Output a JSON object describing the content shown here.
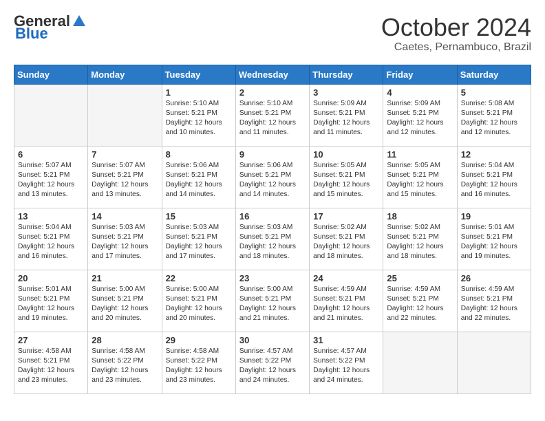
{
  "header": {
    "logo_general": "General",
    "logo_blue": "Blue",
    "month": "October 2024",
    "location": "Caetes, Pernambuco, Brazil"
  },
  "weekdays": [
    "Sunday",
    "Monday",
    "Tuesday",
    "Wednesday",
    "Thursday",
    "Friday",
    "Saturday"
  ],
  "weeks": [
    [
      {
        "day": "",
        "content": ""
      },
      {
        "day": "",
        "content": ""
      },
      {
        "day": "1",
        "content": "Sunrise: 5:10 AM\nSunset: 5:21 PM\nDaylight: 12 hours\nand 10 minutes."
      },
      {
        "day": "2",
        "content": "Sunrise: 5:10 AM\nSunset: 5:21 PM\nDaylight: 12 hours\nand 11 minutes."
      },
      {
        "day": "3",
        "content": "Sunrise: 5:09 AM\nSunset: 5:21 PM\nDaylight: 12 hours\nand 11 minutes."
      },
      {
        "day": "4",
        "content": "Sunrise: 5:09 AM\nSunset: 5:21 PM\nDaylight: 12 hours\nand 12 minutes."
      },
      {
        "day": "5",
        "content": "Sunrise: 5:08 AM\nSunset: 5:21 PM\nDaylight: 12 hours\nand 12 minutes."
      }
    ],
    [
      {
        "day": "6",
        "content": "Sunrise: 5:07 AM\nSunset: 5:21 PM\nDaylight: 12 hours\nand 13 minutes."
      },
      {
        "day": "7",
        "content": "Sunrise: 5:07 AM\nSunset: 5:21 PM\nDaylight: 12 hours\nand 13 minutes."
      },
      {
        "day": "8",
        "content": "Sunrise: 5:06 AM\nSunset: 5:21 PM\nDaylight: 12 hours\nand 14 minutes."
      },
      {
        "day": "9",
        "content": "Sunrise: 5:06 AM\nSunset: 5:21 PM\nDaylight: 12 hours\nand 14 minutes."
      },
      {
        "day": "10",
        "content": "Sunrise: 5:05 AM\nSunset: 5:21 PM\nDaylight: 12 hours\nand 15 minutes."
      },
      {
        "day": "11",
        "content": "Sunrise: 5:05 AM\nSunset: 5:21 PM\nDaylight: 12 hours\nand 15 minutes."
      },
      {
        "day": "12",
        "content": "Sunrise: 5:04 AM\nSunset: 5:21 PM\nDaylight: 12 hours\nand 16 minutes."
      }
    ],
    [
      {
        "day": "13",
        "content": "Sunrise: 5:04 AM\nSunset: 5:21 PM\nDaylight: 12 hours\nand 16 minutes."
      },
      {
        "day": "14",
        "content": "Sunrise: 5:03 AM\nSunset: 5:21 PM\nDaylight: 12 hours\nand 17 minutes."
      },
      {
        "day": "15",
        "content": "Sunrise: 5:03 AM\nSunset: 5:21 PM\nDaylight: 12 hours\nand 17 minutes."
      },
      {
        "day": "16",
        "content": "Sunrise: 5:03 AM\nSunset: 5:21 PM\nDaylight: 12 hours\nand 18 minutes."
      },
      {
        "day": "17",
        "content": "Sunrise: 5:02 AM\nSunset: 5:21 PM\nDaylight: 12 hours\nand 18 minutes."
      },
      {
        "day": "18",
        "content": "Sunrise: 5:02 AM\nSunset: 5:21 PM\nDaylight: 12 hours\nand 18 minutes."
      },
      {
        "day": "19",
        "content": "Sunrise: 5:01 AM\nSunset: 5:21 PM\nDaylight: 12 hours\nand 19 minutes."
      }
    ],
    [
      {
        "day": "20",
        "content": "Sunrise: 5:01 AM\nSunset: 5:21 PM\nDaylight: 12 hours\nand 19 minutes."
      },
      {
        "day": "21",
        "content": "Sunrise: 5:00 AM\nSunset: 5:21 PM\nDaylight: 12 hours\nand 20 minutes."
      },
      {
        "day": "22",
        "content": "Sunrise: 5:00 AM\nSunset: 5:21 PM\nDaylight: 12 hours\nand 20 minutes."
      },
      {
        "day": "23",
        "content": "Sunrise: 5:00 AM\nSunset: 5:21 PM\nDaylight: 12 hours\nand 21 minutes."
      },
      {
        "day": "24",
        "content": "Sunrise: 4:59 AM\nSunset: 5:21 PM\nDaylight: 12 hours\nand 21 minutes."
      },
      {
        "day": "25",
        "content": "Sunrise: 4:59 AM\nSunset: 5:21 PM\nDaylight: 12 hours\nand 22 minutes."
      },
      {
        "day": "26",
        "content": "Sunrise: 4:59 AM\nSunset: 5:21 PM\nDaylight: 12 hours\nand 22 minutes."
      }
    ],
    [
      {
        "day": "27",
        "content": "Sunrise: 4:58 AM\nSunset: 5:21 PM\nDaylight: 12 hours\nand 23 minutes."
      },
      {
        "day": "28",
        "content": "Sunrise: 4:58 AM\nSunset: 5:22 PM\nDaylight: 12 hours\nand 23 minutes."
      },
      {
        "day": "29",
        "content": "Sunrise: 4:58 AM\nSunset: 5:22 PM\nDaylight: 12 hours\nand 23 minutes."
      },
      {
        "day": "30",
        "content": "Sunrise: 4:57 AM\nSunset: 5:22 PM\nDaylight: 12 hours\nand 24 minutes."
      },
      {
        "day": "31",
        "content": "Sunrise: 4:57 AM\nSunset: 5:22 PM\nDaylight: 12 hours\nand 24 minutes."
      },
      {
        "day": "",
        "content": ""
      },
      {
        "day": "",
        "content": ""
      }
    ]
  ]
}
